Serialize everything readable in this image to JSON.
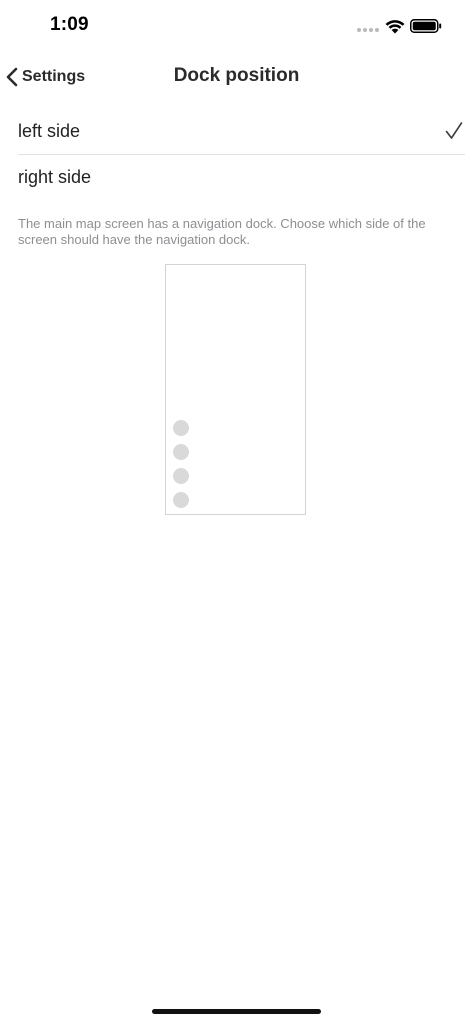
{
  "status_bar": {
    "time": "1:09"
  },
  "nav": {
    "back_label": "Settings",
    "title": "Dock position"
  },
  "options": [
    {
      "label": "left side",
      "selected": true
    },
    {
      "label": "right side",
      "selected": false
    }
  ],
  "description": "The main map screen has a navigation dock. Choose which side of the screen should have the navigation dock.",
  "dock_preview": {
    "side": "left",
    "button_count": 4
  },
  "colors": {
    "text": "#222222",
    "secondary_text": "#8e8e93",
    "separator": "#e2e2e2",
    "dock_dot": "#d9d9d9"
  },
  "icons": {
    "back": "chevron-left-icon",
    "selected": "checkmark-icon",
    "wifi": "wifi-icon",
    "battery": "battery-icon"
  }
}
